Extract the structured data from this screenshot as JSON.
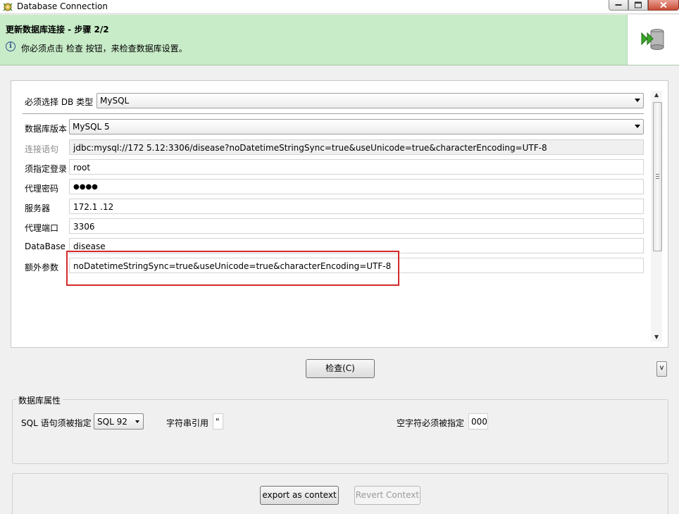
{
  "window": {
    "title": "Database Connection"
  },
  "wizard": {
    "title": "更新数据库连接 - 步骤 2/2",
    "message": "你必须点击 检查 按钮，来检查数据库设置。"
  },
  "form": {
    "db_type": {
      "label": "必须选择 DB 类型",
      "value": "MySQL"
    },
    "db_version": {
      "label": "数据库版本",
      "value": "MySQL 5"
    },
    "connection_string": {
      "label": "连接语句",
      "value": "jdbc:mysql://172        5.12:3306/disease?noDatetimeStringSync=true&useUnicode=true&characterEncoding=UTF-8"
    },
    "login": {
      "label": "须指定登录",
      "value": "root"
    },
    "password": {
      "label": "代理密码",
      "value": "●●●●"
    },
    "server": {
      "label": "服务器",
      "value": "172.1          .12"
    },
    "port": {
      "label": "代理端口",
      "value": "3306"
    },
    "database": {
      "label": "DataBase",
      "value": "disease"
    },
    "extra_params": {
      "label": "额外参数",
      "value": "noDatetimeStringSync=true&useUnicode=true&characterEncoding=UTF-8"
    }
  },
  "check_button": {
    "label": "检查(C)"
  },
  "expand_button": {
    "label": "v"
  },
  "db_properties": {
    "title": "数据库属性",
    "sql_label": "SQL 语句须被指定",
    "sql_value": "SQL 92",
    "quote_label": "字符串引用",
    "quote_value": "\"",
    "null_label": "空字符必须被指定",
    "null_value": "000"
  },
  "context_buttons": {
    "export_label": "export as context",
    "revert_label": "Revert Context"
  },
  "colors": {
    "header_bg": "#c8ecc8",
    "highlight_border": "#d42a2a"
  }
}
